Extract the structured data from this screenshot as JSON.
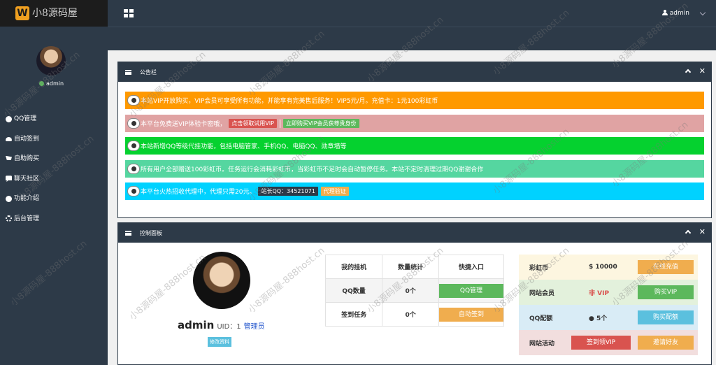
{
  "logo": {
    "letter": "W",
    "text": "小8源码屋"
  },
  "topbar": {
    "username": "admin"
  },
  "sidebar": {
    "username": "admin",
    "items": [
      {
        "label": "QQ管理",
        "icon": "globe-icon"
      },
      {
        "label": "自动签到",
        "icon": "cloud-icon"
      },
      {
        "label": "自助购买",
        "icon": "cart-icon"
      },
      {
        "label": "聊天社区",
        "icon": "chat-icon"
      },
      {
        "label": "功能介绍",
        "icon": "info-icon"
      },
      {
        "label": "后台管理",
        "icon": "gear-icon"
      }
    ]
  },
  "notice_panel": {
    "title": "公告栏",
    "notices": [
      {
        "text": "本站VIP开放购买，VIP会员可享受所有功能，并能享有完美售后服务！VIP5元/月。充值卡：1元100彩虹币",
        "color": "#ff9900"
      },
      {
        "text": "本平台免费送VIP体验卡密哦，",
        "tag1": "点击领取试用VIP",
        "tag2": "立即购买VIP会员获尊贵身份",
        "color": "#e0a3a3"
      },
      {
        "text": "本站新增QQ等级代挂功能，包括电脑管家、手机QQ、电脑QQ、勋章墙等",
        "color": "#05d12f"
      },
      {
        "text": "所有用户全部赠送100彩虹币。任务运行会消耗彩虹币，当彩虹币不足时会自动暂停任务。本站不定时清理过期QQ谢谢合作",
        "color": "#55d6a0"
      },
      {
        "text": "本平台火热招收代理中，代理只需20元。",
        "tag1": "站长QQ：34521071",
        "tag2": "代理验证",
        "color": "#00d2ff"
      }
    ]
  },
  "control_panel": {
    "title": "控制面板",
    "user": {
      "name": "admin",
      "uid_label": "UID：1",
      "role": "管理员",
      "edit_label": "修改资料"
    },
    "table": {
      "headers": [
        "我的挂机",
        "数量统计",
        "快捷入口"
      ],
      "rows": [
        {
          "label": "QQ数量",
          "count": "0个",
          "button": "QQ管理",
          "btn_color": "#5cb85c"
        },
        {
          "label": "签到任务",
          "count": "0个",
          "button": "自动签到",
          "btn_color": "#f0ad4e"
        }
      ]
    },
    "info": [
      {
        "label": "彩虹币",
        "value": "$ 10000",
        "button": "在线充值",
        "row_bg": "#fdf6e0",
        "val_color": "#333",
        "btn_color": "#f0ad4e"
      },
      {
        "label": "网站会员",
        "value": "非 VIP",
        "button": "购买VIP",
        "row_bg": "#e3f1dc",
        "val_color": "#d9534f",
        "btn_color": "#5cb85c"
      },
      {
        "label": "QQ配额",
        "value": "5个",
        "button": "购买配额",
        "row_bg": "#d9ecf6",
        "val_color": "#333",
        "btn_color": "#5bc0de"
      },
      {
        "label": "网站活动",
        "value": "签到领VIP",
        "button": "邀请好友",
        "row_bg": "#f2dede",
        "val_color": "#fff",
        "btn_color": "#f0ad4e",
        "val_btn_color": "#d9534f"
      }
    ]
  },
  "watermark": "小8源码屋-888host.cn"
}
